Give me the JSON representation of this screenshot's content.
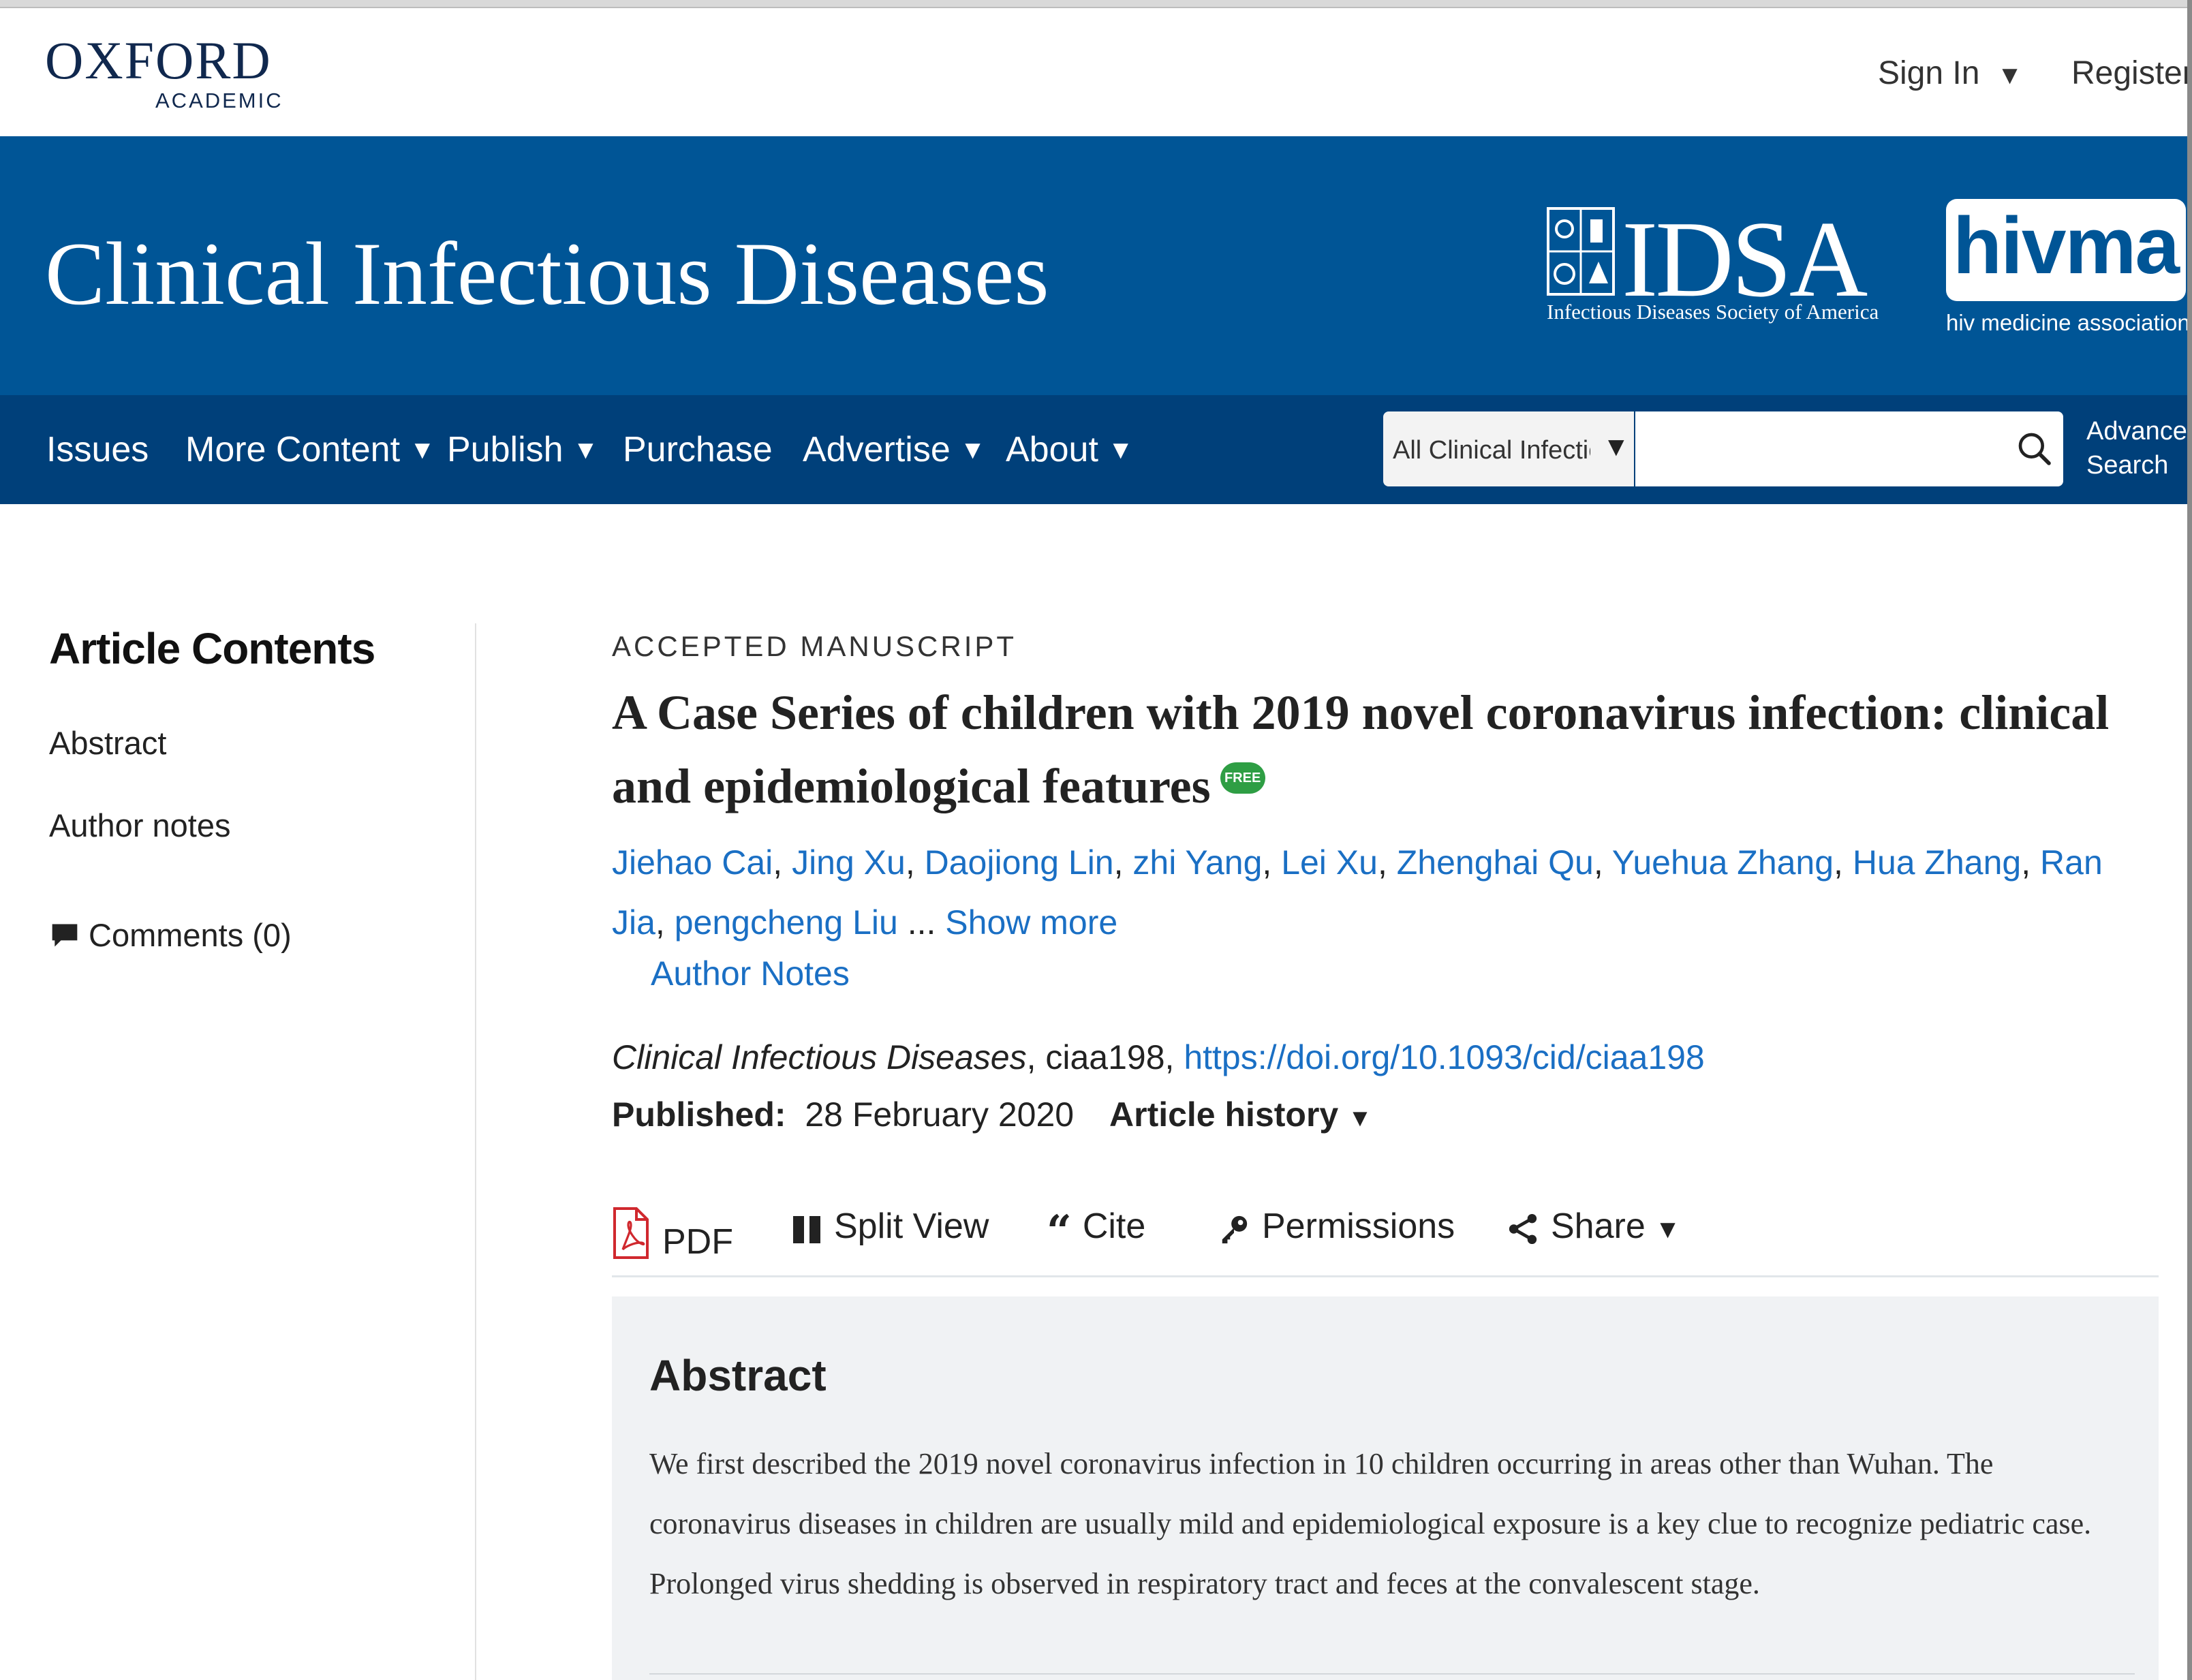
{
  "publisher": {
    "name": "OXFORD",
    "subtitle": "ACADEMIC"
  },
  "account": {
    "sign_in": "Sign In",
    "register": "Register"
  },
  "journal": {
    "title": "Clinical Infectious Diseases",
    "partner_logos": {
      "idsa": "IDSA",
      "idsa_full": "Infectious Diseases Society of America",
      "hivma": "hivma",
      "hivma_full": "hiv medicine association"
    }
  },
  "nav": {
    "items": [
      {
        "label": "Issues",
        "has_dropdown": false
      },
      {
        "label": "More Content",
        "has_dropdown": true
      },
      {
        "label": "Publish",
        "has_dropdown": true
      },
      {
        "label": "Purchase",
        "has_dropdown": false
      },
      {
        "label": "Advertise",
        "has_dropdown": true
      },
      {
        "label": "About",
        "has_dropdown": true
      }
    ],
    "search": {
      "scope": "All Clinical Infectious Diseases",
      "value": "",
      "advanced_line1": "Advanced",
      "advanced_line2": "Search"
    }
  },
  "sidebar": {
    "title": "Article Contents",
    "items": [
      "Abstract",
      "Author notes"
    ],
    "comments": "Comments (0)"
  },
  "article": {
    "type": "ACCEPTED MANUSCRIPT",
    "title": "A Case Series of children with 2019 novel coronavirus infection: clinical and epidemiological features",
    "free_badge": "FREE",
    "authors": [
      "Jiehao Cai",
      "Jing Xu",
      "Daojiong Lin",
      "zhi Yang",
      "Lei Xu",
      "Zhenghai Qu",
      "Yuehua Zhang",
      "Hua Zhang",
      "Ran Jia",
      "pengcheng Liu"
    ],
    "ellipsis": "...",
    "show_more": "Show more",
    "author_notes": "Author Notes",
    "journal_name": "Clinical Infectious Diseases",
    "article_id": ", ciaa198, ",
    "doi": "https://doi.org/10.1093/cid/ciaa198",
    "published_label": "Published:",
    "published_date": "28 February 2020",
    "history_label": "Article history"
  },
  "toolbar": {
    "pdf": "PDF",
    "split_view": "Split View",
    "cite": "Cite",
    "permissions": "Permissions",
    "share": "Share"
  },
  "abstract": {
    "heading": "Abstract",
    "text": "We first described the 2019 novel coronavirus infection in 10 children occurring in areas other than Wuhan. The coronavirus diseases in children are usually mild and epidemiological exposure is a key clue to recognize pediatric case. Prolonged virus shedding is observed in respiratory tract and feces at the convalescent stage."
  },
  "colors": {
    "banner": "#005596",
    "navbar": "#00407a",
    "link": "#1a6fc4",
    "free_badge": "#2e9e44"
  }
}
